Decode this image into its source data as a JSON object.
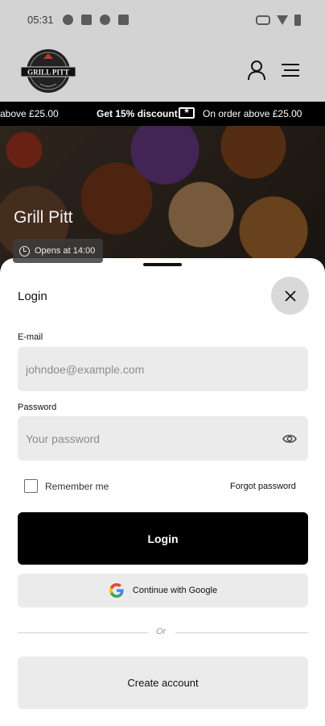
{
  "status_bar": {
    "time": "05:31"
  },
  "header": {
    "logo_text": "GRILL PITT"
  },
  "ticker": {
    "segment_left": "above £25.00",
    "segment_middle": "Get 15% discount",
    "segment_right": "On order above £25.00"
  },
  "hero": {
    "restaurant_name": "Grill Pitt",
    "opening_text": "Opens at 14:00"
  },
  "login_sheet": {
    "title": "Login",
    "email": {
      "label": "E-mail",
      "placeholder": "johndoe@example.com",
      "value": ""
    },
    "password": {
      "label": "Password",
      "placeholder": "Your password",
      "value": ""
    },
    "remember_label": "Remember me",
    "remember_checked": false,
    "forgot_label": "Forgot password",
    "login_button": "Login",
    "google_button": "Continue with Google",
    "divider_text": "Or",
    "create_account_button": "Create account"
  },
  "colors": {
    "primary_button": "#000000",
    "secondary_button": "#ebebeb",
    "header_bg": "#d3d3d3"
  },
  "icons": [
    "user-icon",
    "hamburger-menu-icon",
    "ticket-icon",
    "clock-icon",
    "close-icon",
    "eye-icon",
    "google-icon"
  ]
}
